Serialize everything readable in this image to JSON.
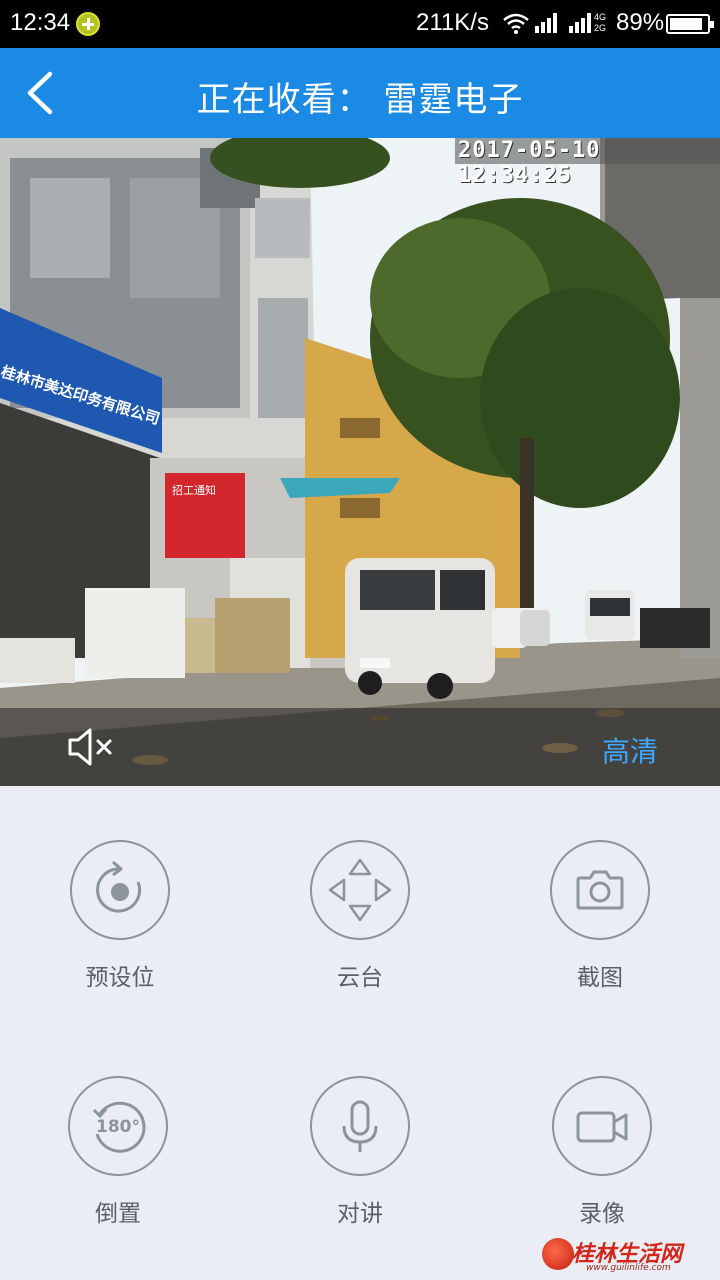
{
  "status_bar": {
    "time": "12:34",
    "net_speed": "211K/s",
    "network_type": "4G\n2G",
    "battery_percent": "89%",
    "battery_level": 0.89
  },
  "header": {
    "title": "正在收看：  雷霆电子",
    "back_icon": "chevron-left-icon"
  },
  "video": {
    "timestamp": "2017-05-10 12:34:25",
    "quality_label": "高清",
    "mute_icon": "speaker-muted-icon",
    "scene_text": {
      "shop_sign": "桂林市美达印务有限公司",
      "red_banner": "招工通知"
    }
  },
  "controls": [
    {
      "label": "预设位",
      "icon": "preset-position-icon"
    },
    {
      "label": "云台",
      "icon": "ptz-direction-icon"
    },
    {
      "label": "截图",
      "icon": "camera-icon"
    },
    {
      "label": "倒置",
      "icon": "rotate-180-icon"
    },
    {
      "label": "对讲",
      "icon": "microphone-icon"
    },
    {
      "label": "录像",
      "icon": "video-camera-icon"
    }
  ],
  "watermark": {
    "text": "桂林生活网",
    "url": "www.guilinlife.com"
  }
}
